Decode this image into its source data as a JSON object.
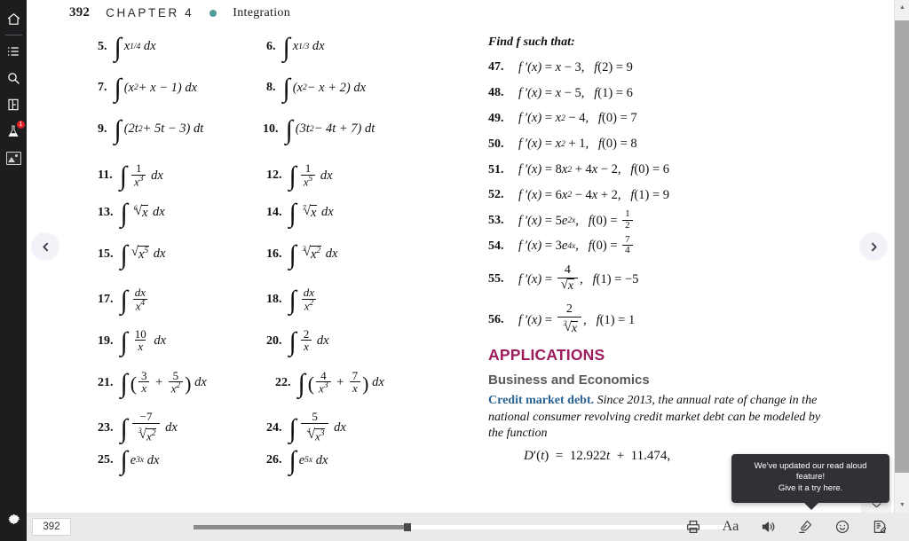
{
  "rail": {
    "items": [
      {
        "name": "home-icon",
        "label": "Home"
      },
      {
        "name": "contents-icon",
        "label": "Table of Contents"
      },
      {
        "name": "search-icon",
        "label": "Search"
      },
      {
        "name": "bookmark-icon",
        "label": "Bookmarks"
      },
      {
        "name": "flask-icon",
        "label": "Study Tools",
        "badge": "1"
      },
      {
        "name": "media-icon",
        "label": "Media"
      }
    ],
    "settings_label": "Settings"
  },
  "runhead": {
    "page_number": "392",
    "chapter": "CHAPTER 4",
    "dot_color": "#4f9d9d",
    "title": "Integration"
  },
  "exercises_left": [
    {
      "n": "5.",
      "body": "∫ x^(1/4) dx"
    },
    {
      "n": "6.",
      "body": "∫ x^(1/3) dx"
    },
    {
      "n": "7.",
      "body": "∫ (x^2 + x − 1) dx"
    },
    {
      "n": "8.",
      "body": "∫ (x^2 − x + 2) dx"
    },
    {
      "n": "9.",
      "body": "∫ (2t^2 + 5t − 3) dt"
    },
    {
      "n": "10.",
      "body": "∫ (3t^2 − 4t + 7) dt"
    },
    {
      "n": "11.",
      "body": "∫ 1/x^3 dx"
    },
    {
      "n": "12.",
      "body": "∫ 1/x^5 dx"
    },
    {
      "n": "13.",
      "body": "∫ ⁶√x dx"
    },
    {
      "n": "14.",
      "body": "∫ ⁷√x dx"
    },
    {
      "n": "15.",
      "body": "∫ √(x^5) dx"
    },
    {
      "n": "16.",
      "body": "∫ ³√(x^2) dx"
    },
    {
      "n": "17.",
      "body": "∫ dx/x^4"
    },
    {
      "n": "18.",
      "body": "∫ dx/x^2"
    },
    {
      "n": "19.",
      "body": "∫ 10/x dx"
    },
    {
      "n": "20.",
      "body": "∫ 2/x dx"
    },
    {
      "n": "21.",
      "body": "∫ (3/x + 5/x^2) dx"
    },
    {
      "n": "22.",
      "body": "∫ (4/x^3 + 7/x) dx"
    },
    {
      "n": "23.",
      "body": "∫ −7/³√(x^2) dx"
    },
    {
      "n": "24.",
      "body": "∫ 5/⁴√(x^3) dx"
    },
    {
      "n": "25.",
      "body": "∫ e^(3x) dx"
    },
    {
      "n": "26.",
      "body": "∫ e^(5x) dx"
    }
  ],
  "right": {
    "find_f_heading": "Find f such that:",
    "problems": [
      {
        "n": "47.",
        "eq": "f'(x) = x − 3,",
        "cond": "f(2) = 9"
      },
      {
        "n": "48.",
        "eq": "f'(x) = x − 5,",
        "cond": "f(1) = 6"
      },
      {
        "n": "49.",
        "eq": "f'(x) = x² − 4,",
        "cond": "f(0) = 7"
      },
      {
        "n": "50.",
        "eq": "f'(x) = x² + 1,",
        "cond": "f(0) = 8"
      },
      {
        "n": "51.",
        "eq": "f'(x) = 8x² + 4x − 2,",
        "cond": "f(0) = 6"
      },
      {
        "n": "52.",
        "eq": "f'(x) = 6x² − 4x + 2,",
        "cond": "f(1) = 9"
      },
      {
        "n": "53.",
        "eq": "f'(x) = 5e^{2x},",
        "cond": "f(0) = 1/2"
      },
      {
        "n": "54.",
        "eq": "f'(x) = 3e^{4x},",
        "cond": "f(0) = 7/4"
      },
      {
        "n": "55.",
        "eq": "f'(x) = 4/√x,",
        "cond": "f(1) = −5"
      },
      {
        "n": "56.",
        "eq": "f'(x) = 2/³√x,",
        "cond": "f(1) = 1"
      }
    ],
    "applications_heading": "APPLICATIONS",
    "applications_color": "#9c1c5e",
    "subsection_heading": "Business and Economics",
    "article_lead": "Credit market debt.",
    "article_lead_color": "#2a6496",
    "article_text": "Since 2013, the annual rate of change in the national consumer revolving credit market debt can be modeled by the function",
    "display_equation": "D′(t) = 12.922t + 11.474,"
  },
  "tooltip": {
    "line1": "We've updated our read aloud feature!",
    "line2": "Give it a try here."
  },
  "bottombar": {
    "page_input_value": "392",
    "prev_page_label": "Previous page",
    "next_page_label": "Next page",
    "collapse_label": "Hide toolbar"
  },
  "tools": [
    {
      "name": "print-icon",
      "label": "Print"
    },
    {
      "name": "text-size-icon",
      "label": "Aa"
    },
    {
      "name": "read-aloud-icon",
      "label": "Read aloud"
    },
    {
      "name": "highlighter-icon",
      "label": "Highlighter"
    },
    {
      "name": "emoji-icon",
      "label": "Reactions"
    },
    {
      "name": "notes-icon",
      "label": "Notes"
    }
  ]
}
